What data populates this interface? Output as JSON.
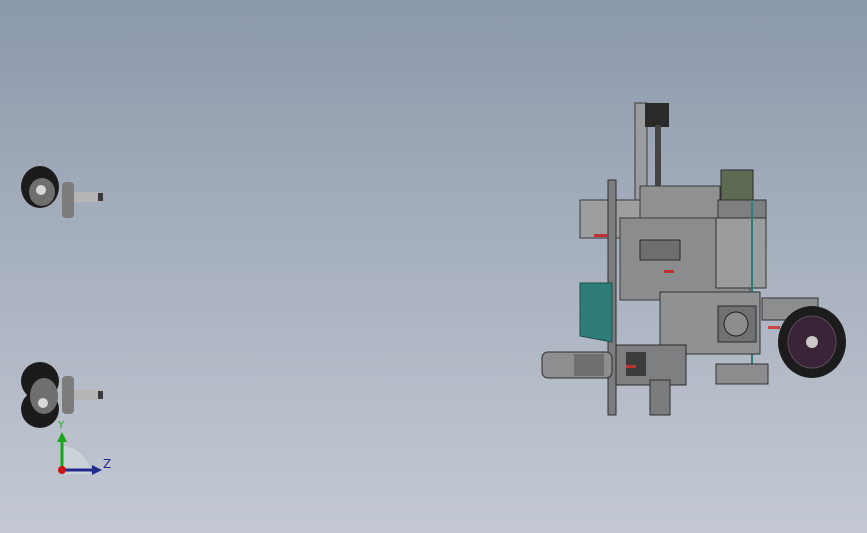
{
  "app": {
    "title": ""
  },
  "view": {
    "background_top": "#8b98ab",
    "background_bottom": "#c4c9d3"
  },
  "triad": {
    "y_label": "Y",
    "z_label": "Z",
    "y_color": "#1aa51a",
    "z_color": "#1f2a8c",
    "origin_color": "#c81414"
  },
  "model": {
    "parts": [
      "caster-wheel-top",
      "caster-wheel-bottom",
      "robot-assembly"
    ],
    "accent_color": "#2f7d78",
    "metal_color": "#8f9193",
    "dark_color": "#2a2a2a"
  }
}
